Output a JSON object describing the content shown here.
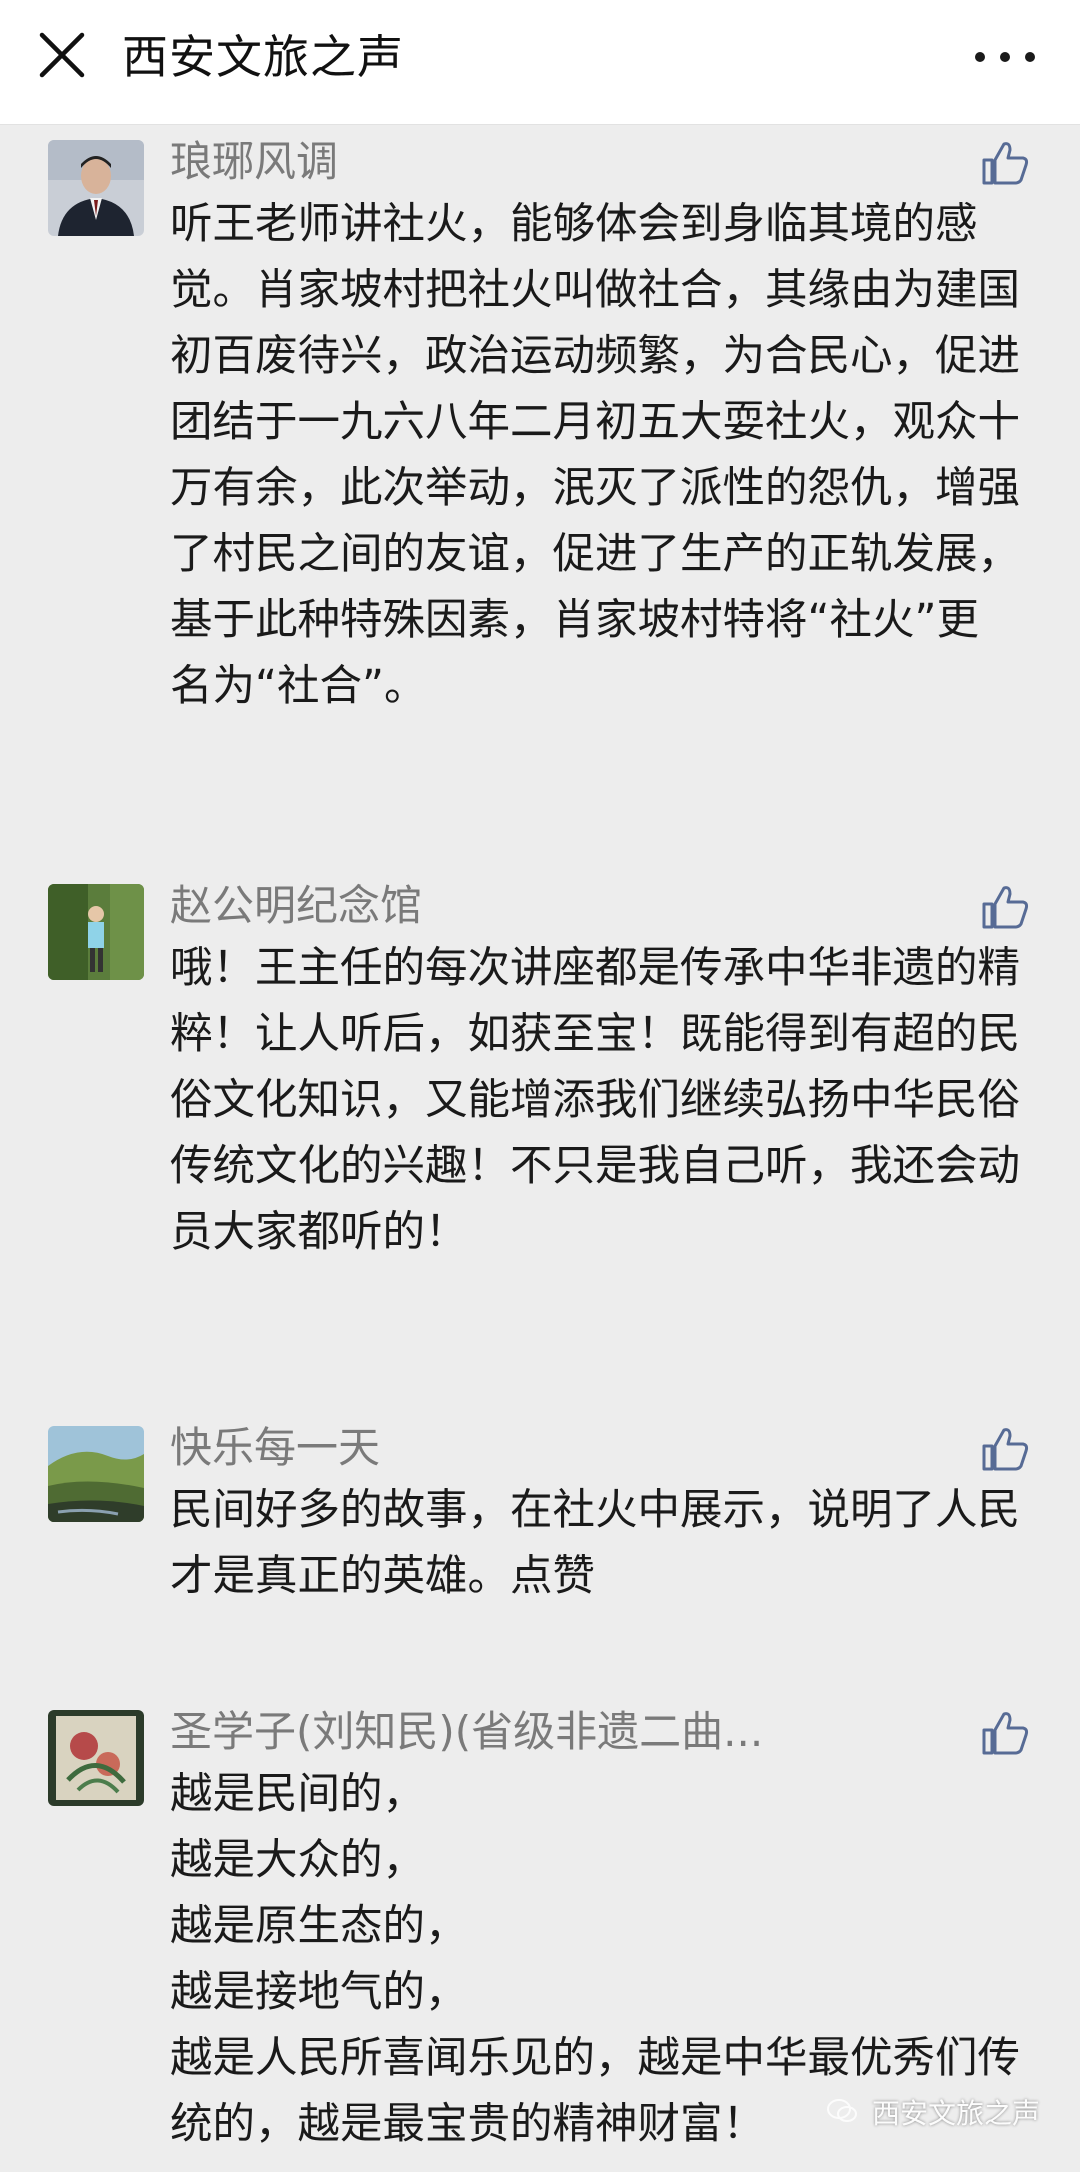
{
  "header": {
    "title": "西安文旅之声"
  },
  "comments": [
    {
      "author": "琅琊风调",
      "content": "听王老师讲社火，能够体会到身临其境的感觉。肖家坡村把社火叫做社合，其缘由为建国初百废待兴，政治运动频繁，为合民心，促进团结于一九六八年二月初五大耍社火，观众十万有余，此次举动，泯灭了派性的怨仇，增强了村民之间的友谊，促进了生产的正轨发展，基于此种特殊因素，肖家坡村特将“社火”更名为“社合”。"
    },
    {
      "author": "赵公明纪念馆",
      "content": "哦！王主任的每次讲座都是传承中华非遗的精粹！让人听后，如获至宝！既能得到有超的民俗文化知识，又能增添我们继续弘扬中华民俗传统文化的兴趣！不只是我自己听，我还会动员大家都听的！"
    },
    {
      "author": "快乐每一天",
      "content": "民间好多的故事，在社火中展示，说明了人民才是真正的英雄。点赞"
    },
    {
      "author": "圣学子(刘知民)(省级非遗二曲...",
      "content": "越是民间的，\n越是大众的，\n越是原生态的，\n越是接地气的，\n越是人民所喜闻乐见的，越是中华最优秀们传统的，越是最宝贵的精神财富！"
    }
  ],
  "watermark": "西安文旅之声",
  "icons": {
    "close": "close-icon",
    "more": "more-icon",
    "like": "thumbs-up-icon"
  },
  "colors": {
    "background": "#ededed",
    "author": "#7a7a7a",
    "text": "#1a1a1a"
  }
}
